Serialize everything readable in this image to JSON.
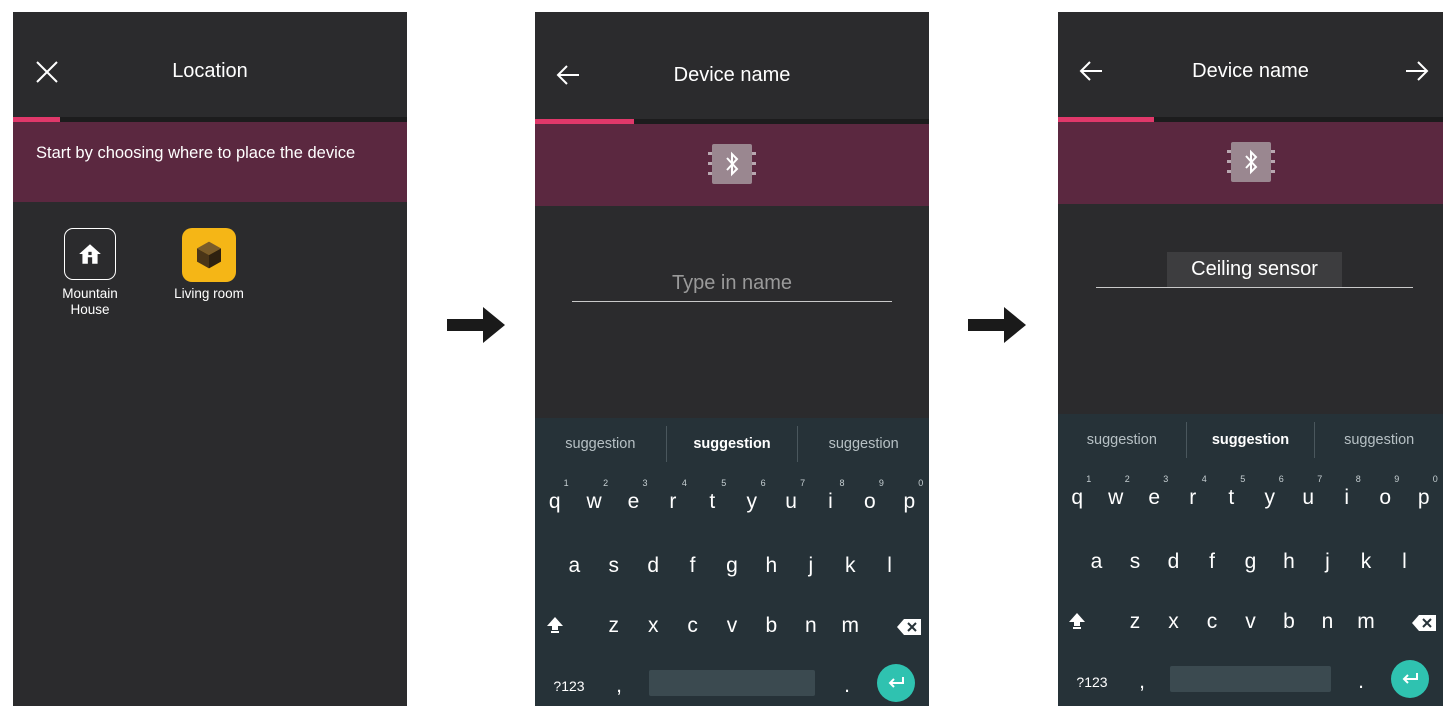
{
  "screen1": {
    "title": "Location",
    "banner_text": "Start by choosing where to place the device",
    "locations": [
      {
        "label": "Mountain House",
        "icon": "house-icon"
      },
      {
        "label": "Living room",
        "icon": "cube-icon"
      }
    ],
    "progress": 0.12
  },
  "screen2": {
    "title": "Device name",
    "name_placeholder": "Type in name",
    "progress": 0.25
  },
  "screen3": {
    "title": "Device name",
    "name_value": "Ceiling sensor",
    "progress": 0.25
  },
  "keyboard": {
    "suggestions": [
      "suggestion",
      "suggestion",
      "suggestion"
    ],
    "row1": [
      "q",
      "w",
      "e",
      "r",
      "t",
      "y",
      "u",
      "i",
      "o",
      "p"
    ],
    "row1_hints": [
      "1",
      "2",
      "3",
      "4",
      "5",
      "6",
      "7",
      "8",
      "9",
      "0"
    ],
    "row2": [
      "a",
      "s",
      "d",
      "f",
      "g",
      "h",
      "j",
      "k",
      "l"
    ],
    "row3": [
      "z",
      "x",
      "c",
      "v",
      "b",
      "n",
      "m"
    ],
    "symbols_key": "?123",
    "comma_key": ",",
    "period_key": "."
  },
  "colors": {
    "screen_bg": "#2b2b2d",
    "banner": "#5b2840",
    "progress_accent": "#e0386a",
    "keyboard_bg": "#263238",
    "enter_key": "#2fc2b0",
    "location_selected": "#f5b616"
  },
  "icons": {
    "close": "close-icon",
    "back": "arrow-left-icon",
    "forward": "arrow-right-icon",
    "device": "bluetooth-chip-icon",
    "flow": "arrow-right-icon"
  }
}
